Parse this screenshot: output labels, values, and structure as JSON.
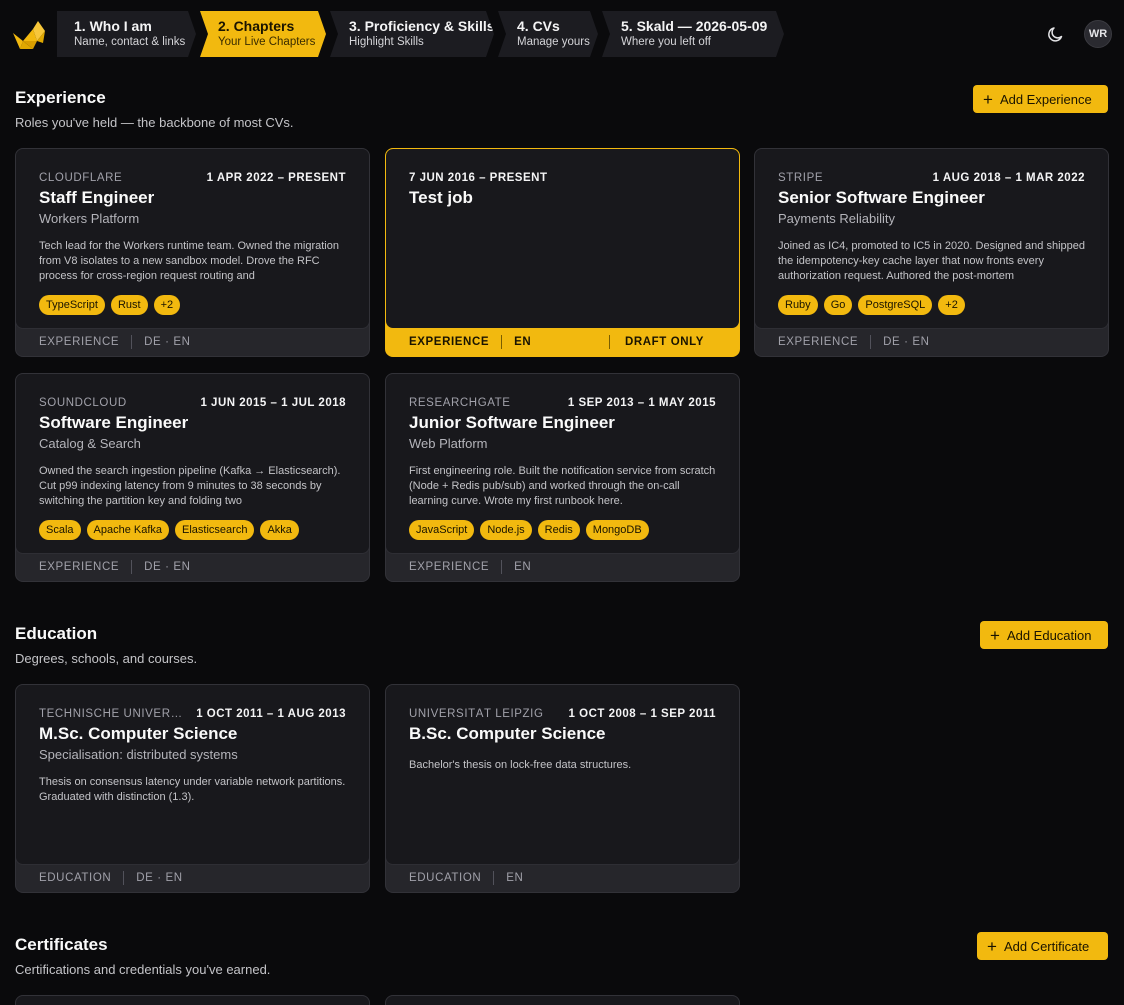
{
  "header": {
    "steps": [
      {
        "title": "1. Who I am",
        "subtitle": "Name, contact & links",
        "active": false
      },
      {
        "title": "2. Chapters",
        "subtitle": "Your Live Chapters",
        "active": true
      },
      {
        "title": "3. Proficiency & Skills",
        "subtitle": "Highlight Skills",
        "active": false
      },
      {
        "title": "4. CVs",
        "subtitle": "Manage yours",
        "active": false
      },
      {
        "title": "5. Skald — 2026-05-09",
        "subtitle": "Where you left off",
        "active": false
      }
    ],
    "avatar_initials": "WR",
    "theme_icon": "moon-icon",
    "logo_icon": "bird-logo"
  },
  "experience": {
    "title": "Experience",
    "subtitle": "Roles you've held — the backbone of most CVs.",
    "add_label": "Add Experience",
    "cards": [
      {
        "company": "CLOUDFLARE",
        "dates": "1 APR 2022 – PRESENT",
        "role": "Staff Engineer",
        "team": "Workers Platform",
        "description": "Tech lead for the Workers runtime team. Owned the migration from V8 isolates to a new sandbox model. Drove the RFC process for cross-region request routing and",
        "tags": [
          "TypeScript",
          "Rust",
          "+2"
        ],
        "type": "EXPERIENCE",
        "langs": "DE · EN",
        "draft": ""
      },
      {
        "company": "",
        "dates": "7 JUN 2016 – PRESENT",
        "role": "Test job",
        "team": "",
        "description": "",
        "tags": [],
        "type": "EXPERIENCE",
        "langs": "EN",
        "draft": "DRAFT ONLY"
      },
      {
        "company": "STRIPE",
        "dates": "1 AUG 2018 – 1 MAR 2022",
        "role": "Senior Software Engineer",
        "team": "Payments Reliability",
        "description": "Joined as IC4, promoted to IC5 in 2020. Designed and shipped the idempotency-key cache layer that now fronts every authorization request. Authored the post-mortem",
        "tags": [
          "Ruby",
          "Go",
          "PostgreSQL",
          "+2"
        ],
        "type": "EXPERIENCE",
        "langs": "DE · EN",
        "draft": ""
      },
      {
        "company": "SOUNDCLOUD",
        "dates": "1 JUN 2015 – 1 JUL 2018",
        "role": "Software Engineer",
        "team": "Catalog & Search",
        "description": "Owned the search ingestion pipeline (Kafka → Elasticsearch). Cut p99 indexing latency from 9 minutes to 38 seconds by switching the partition key and folding two",
        "tags": [
          "Scala",
          "Apache Kafka",
          "Elasticsearch",
          "Akka"
        ],
        "type": "EXPERIENCE",
        "langs": "DE · EN",
        "draft": ""
      },
      {
        "company": "RESEARCHGATE",
        "dates": "1 SEP 2013 – 1 MAY 2015",
        "role": "Junior Software Engineer",
        "team": "Web Platform",
        "description": "First engineering role. Built the notification service from scratch (Node + Redis pub/sub) and worked through the on-call learning curve. Wrote my first runbook here.",
        "tags": [
          "JavaScript",
          "Node.js",
          "Redis",
          "MongoDB"
        ],
        "type": "EXPERIENCE",
        "langs": "EN",
        "draft": ""
      }
    ]
  },
  "education": {
    "title": "Education",
    "subtitle": "Degrees, schools, and courses.",
    "add_label": "Add Education",
    "cards": [
      {
        "company": "TECHNISCHE UNIVERSITÄT MÜNCHEN",
        "dates": "1 OCT 2011 – 1 AUG 2013",
        "role": "M.Sc. Computer Science",
        "team": "Specialisation: distributed systems",
        "description": "Thesis on consensus latency under variable network partitions. Graduated with distinction (1.3).",
        "tags": [],
        "type": "EDUCATION",
        "langs": "DE · EN",
        "draft": ""
      },
      {
        "company": "UNIVERSITÄT LEIPZIG",
        "dates": "1 OCT 2008 – 1 SEP 2011",
        "role": "B.Sc. Computer Science",
        "team": "",
        "description": "Bachelor's thesis on lock-free data structures.",
        "tags": [],
        "type": "EDUCATION",
        "langs": "EN",
        "draft": ""
      }
    ]
  },
  "certificates": {
    "title": "Certificates",
    "subtitle": "Certifications and credentials you've earned.",
    "add_label": "Add Certificate"
  },
  "colors": {
    "accent": "#f2b90f",
    "background": "#0a0a0c",
    "card": "#18181c"
  }
}
